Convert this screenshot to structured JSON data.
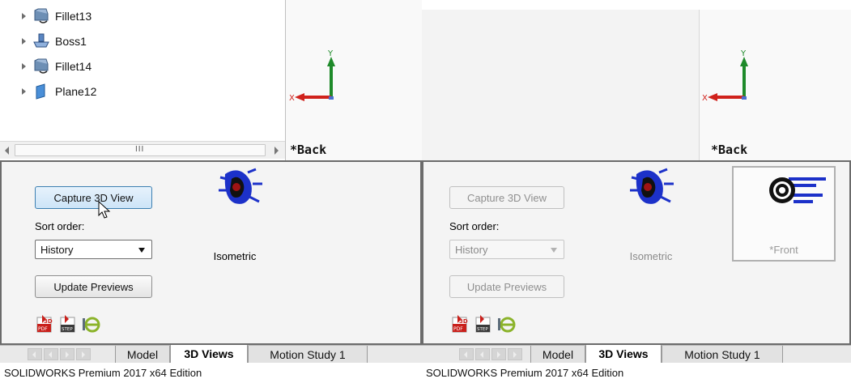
{
  "left": {
    "feature_tree": {
      "items": [
        {
          "label": "Fillet13",
          "icon": "fillet-icon"
        },
        {
          "label": "Boss1",
          "icon": "boss-extrude-icon"
        },
        {
          "label": "Fillet14",
          "icon": "fillet-icon"
        },
        {
          "label": "Plane12",
          "icon": "plane-icon"
        }
      ],
      "scroll_grip": "III"
    },
    "viewport": {
      "view_name": "*Back",
      "x_axis": "X",
      "y_axis": "Y"
    },
    "panel": {
      "capture_button": "Capture 3D View",
      "sort_label": "Sort order:",
      "sort_value": "History",
      "update_button": "Update Previews",
      "views": [
        {
          "caption": "Isometric"
        }
      ],
      "export_icons": [
        "3d-pdf-icon",
        "step-export-icon",
        "edrawings-icon"
      ]
    },
    "tabs": [
      "Model",
      "3D Views",
      "Motion Study 1"
    ],
    "active_tab": "3D Views",
    "status": "SOLIDWORKS Premium 2017 x64 Edition"
  },
  "right": {
    "viewport": {
      "view_name": "*Back",
      "x_axis": "X",
      "y_axis": "Y"
    },
    "panel": {
      "capture_button": "Capture 3D View",
      "sort_label": "Sort order:",
      "sort_value": "History",
      "update_button": "Update Previews",
      "views": [
        {
          "caption": "Isometric"
        },
        {
          "caption": "*Front"
        }
      ],
      "export_icons": [
        "3d-pdf-icon",
        "step-export-icon",
        "edrawings-icon"
      ]
    },
    "tabs": [
      "Model",
      "3D Views",
      "Motion Study 1"
    ],
    "active_tab": "3D Views",
    "status": "SOLIDWORKS Premium 2017 x64 Edition"
  },
  "colors": {
    "axis_y": "#1e8a2a",
    "axis_x": "#d0221c",
    "active_button_border": "#3c7fb1",
    "panel_border": "#6b6b6b",
    "part_blue": "#1c31c9"
  }
}
